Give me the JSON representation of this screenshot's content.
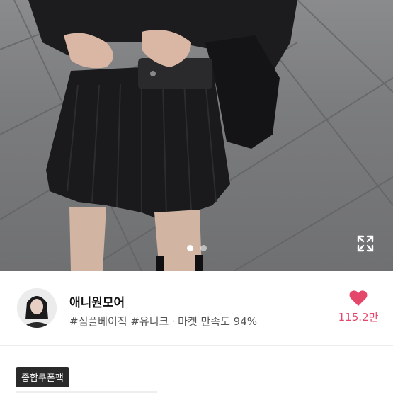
{
  "gallery": {
    "image_alt": "black pleated skirt outfit",
    "dot_count": 2,
    "active_dot": 1,
    "expand_icon": "expand-icon"
  },
  "shop": {
    "name": "애니원모어",
    "tag1": "#심플베이직",
    "tag2": "#유니크",
    "separator": "·",
    "satisfaction": "마켓 만족도 94%",
    "like_count": "115.2만",
    "heart_icon": "heart-icon",
    "heart_color": "#e5476b"
  },
  "coupon": {
    "badge_label": "종합쿠폰팩"
  }
}
